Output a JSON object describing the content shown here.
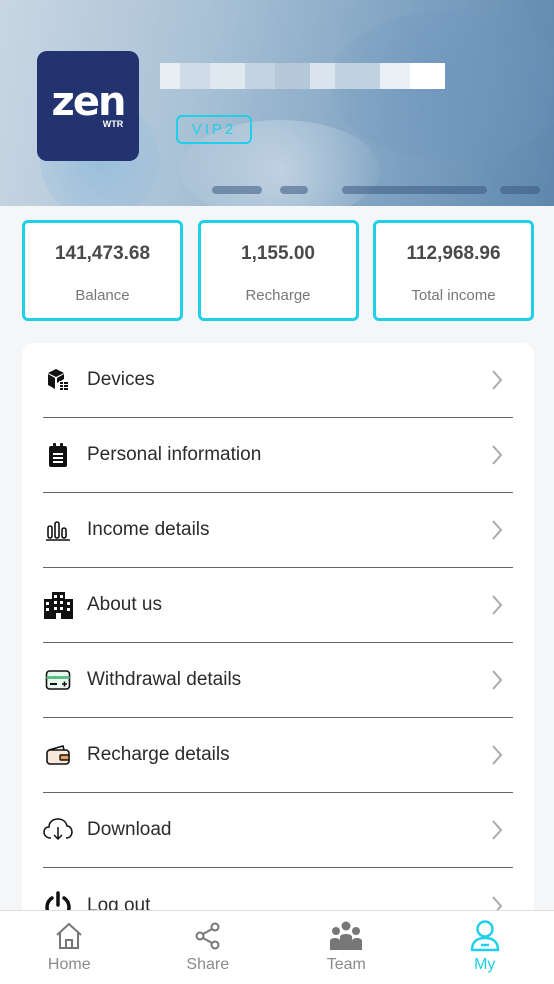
{
  "profile": {
    "logo_text": "zen",
    "logo_sub": "WTR",
    "vip_badge": "VIP2"
  },
  "stats": [
    {
      "value": "141,473.68",
      "label": "Balance"
    },
    {
      "value": "1,155.00",
      "label": "Recharge"
    },
    {
      "value": "112,968.96",
      "label": "Total income"
    }
  ],
  "menu": [
    {
      "label": "Devices",
      "icon": "devices-icon"
    },
    {
      "label": "Personal information",
      "icon": "clipboard-icon"
    },
    {
      "label": "Income details",
      "icon": "bar-chart-icon"
    },
    {
      "label": "About us",
      "icon": "building-icon"
    },
    {
      "label": "Withdrawal details",
      "icon": "card-icon"
    },
    {
      "label": "Recharge details",
      "icon": "wallet-icon"
    },
    {
      "label": "Download",
      "icon": "cloud-download-icon"
    },
    {
      "label": "Log out",
      "icon": "power-icon"
    }
  ],
  "nav": [
    {
      "label": "Home",
      "icon": "home-icon"
    },
    {
      "label": "Share",
      "icon": "share-icon"
    },
    {
      "label": "Team",
      "icon": "team-icon"
    },
    {
      "label": "My",
      "icon": "user-icon",
      "active": true
    }
  ],
  "colors": {
    "accent": "#1fd0e8",
    "logo_bg": "#22336f"
  }
}
